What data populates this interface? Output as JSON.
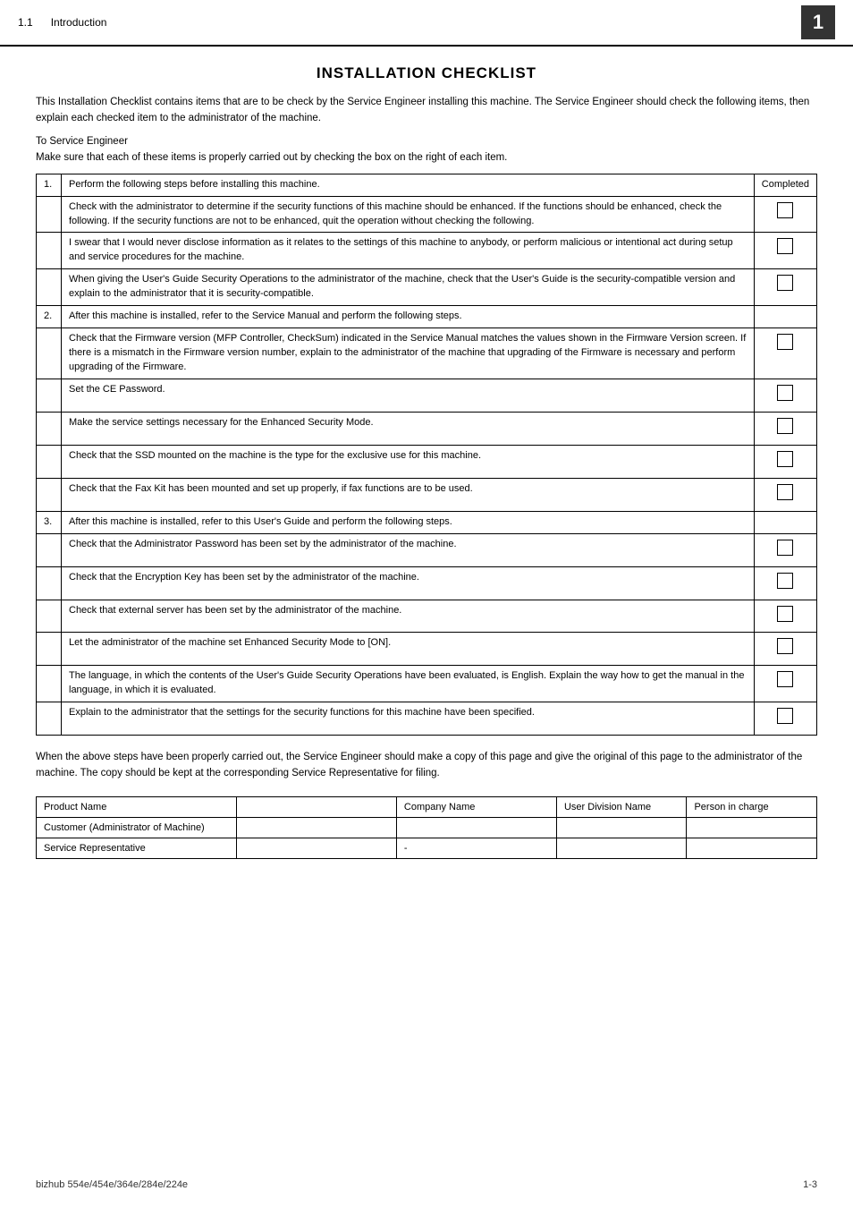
{
  "header": {
    "section": "1.1",
    "section_title": "Introduction",
    "chapter_num": "1"
  },
  "title": "INSTALLATION CHECKLIST",
  "intro": {
    "p1": "This Installation Checklist contains items that are to be check by the Service Engineer installing this machine. The Service Engineer should check the following items, then explain each checked item to the administrator of the machine.",
    "p2": "To Service Engineer",
    "p3": "Make sure that each of these items is properly carried out by checking the box on the right of each item."
  },
  "checklist": {
    "col_completed": "Completed",
    "steps": [
      {
        "num": "1.",
        "desc": "Perform the following steps before installing this machine.",
        "has_checkbox": false,
        "sub_items": [
          {
            "text": "Check with the administrator to determine if the security functions of this machine should be enhanced. If the functions should be enhanced, check the following. If the security functions are not to be enhanced, quit the operation without checking the following.",
            "has_checkbox": true
          },
          {
            "text": "I swear that I would never disclose information as it relates to the settings of this machine to anybody, or perform malicious or intentional act during setup and service procedures for the machine.",
            "has_checkbox": true
          },
          {
            "text": "When giving the User's Guide Security Operations to the administrator of the machine, check that the User's Guide is the security-compatible version and explain to the administrator that it is security-compatible.",
            "has_checkbox": true
          }
        ]
      },
      {
        "num": "2.",
        "desc": "After this machine is installed, refer to the Service Manual and perform the following steps.",
        "has_checkbox": false,
        "sub_items": [
          {
            "text": "Check that the Firmware version (MFP Controller, CheckSum) indicated in the Service Manual matches the values shown in the Firmware Version screen. If there is a mismatch in the Firmware version number, explain to the administrator of the machine that upgrading of the Firmware is necessary and perform upgrading of the Firmware.",
            "has_checkbox": true
          },
          {
            "text": "Set the CE Password.",
            "has_checkbox": true
          },
          {
            "text": "Make the service settings necessary for the Enhanced Security Mode.",
            "has_checkbox": true
          },
          {
            "text": "Check that the SSD mounted on the machine is the type for the exclusive use for this machine.",
            "has_checkbox": true
          },
          {
            "text": "Check that the Fax Kit has been mounted and set up properly, if fax functions are to be used.",
            "has_checkbox": true
          }
        ]
      },
      {
        "num": "3.",
        "desc": "After this machine is installed, refer to this User's Guide and perform the following steps.",
        "has_checkbox": false,
        "sub_items": [
          {
            "text": "Check that the Administrator Password has been set by the administrator of the machine.",
            "has_checkbox": true
          },
          {
            "text": "Check that the Encryption Key has been set by the administrator of the machine.",
            "has_checkbox": true
          },
          {
            "text": "Check that external server has been set by the administrator of the machine.",
            "has_checkbox": true
          },
          {
            "text": "Let the administrator of the machine set Enhanced Security Mode to [ON].",
            "has_checkbox": true
          },
          {
            "text": "The language, in which the contents of the User's Guide Security Operations have been evaluated, is English. Explain the way how to get the manual in the language, in which it is evaluated.",
            "has_checkbox": true
          },
          {
            "text": "Explain to the administrator that the settings for the security functions for this machine have been specified.",
            "has_checkbox": true
          }
        ]
      }
    ]
  },
  "footer_text": "When the above steps have been properly carried out, the Service Engineer should make a copy of this page and give the original of this page to the administrator of the machine. The copy should be kept at the corresponding Service Representative for filing.",
  "info_table": {
    "col1": "Product Name",
    "col2": "Company Name",
    "col3": "User Division Name",
    "col4": "Person in charge",
    "row1_label": "Customer (Administrator of Machine)",
    "row2_label": "Service Representative",
    "row2_col2_value": "-"
  },
  "page_footer": {
    "left": "bizhub 554e/454e/364e/284e/224e",
    "right": "1-3"
  }
}
